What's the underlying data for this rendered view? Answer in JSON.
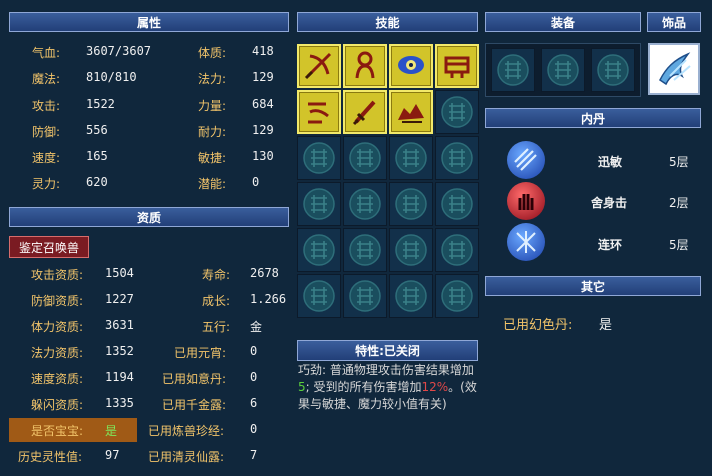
{
  "attributes": {
    "title": "属性",
    "rows": [
      {
        "l1": "气血:",
        "v1": "3607/3607",
        "l2": "体质:",
        "v2": "418"
      },
      {
        "l1": "魔法:",
        "v1": "810/810",
        "l2": "法力:",
        "v2": "129"
      },
      {
        "l1": "攻击:",
        "v1": "1522",
        "l2": "力量:",
        "v2": "684"
      },
      {
        "l1": "防御:",
        "v1": "556",
        "l2": "耐力:",
        "v2": "129"
      },
      {
        "l1": "速度:",
        "v1": "165",
        "l2": "敏捷:",
        "v2": "130"
      },
      {
        "l1": "灵力:",
        "v1": "620",
        "l2": "潜能:",
        "v2": "0"
      }
    ]
  },
  "aptitude": {
    "title": "资质",
    "appraise_button": "鉴定召唤兽",
    "rows": [
      {
        "l1": "攻击资质:",
        "v1": "1504",
        "l2": "寿命:",
        "v2": "2678"
      },
      {
        "l1": "防御资质:",
        "v1": "1227",
        "l2": "成长:",
        "v2": "1.266"
      },
      {
        "l1": "体力资质:",
        "v1": "3631",
        "l2": "五行:",
        "v2": "金"
      },
      {
        "l1": "法力资质:",
        "v1": "1352",
        "l2": "已用元宵:",
        "v2": "0"
      },
      {
        "l1": "速度资质:",
        "v1": "1194",
        "l2": "已用如意丹:",
        "v2": "0"
      },
      {
        "l1": "躲闪资质:",
        "v1": "1335",
        "l2": "已用千金露:",
        "v2": "6"
      },
      {
        "l1": "是否宝宝:",
        "v1": "是",
        "l2": "已用炼兽珍经:",
        "v2": "0"
      },
      {
        "l1": "历史灵性值:",
        "v1": "97",
        "l2": "已用清灵仙露:",
        "v2": "7"
      }
    ]
  },
  "skills": {
    "title": "技能",
    "filled_icons": [
      "bow-skill-icon",
      "monk-skill-icon",
      "eye-skill-icon",
      "chest-skill-icon",
      "bow-break-skill-icon",
      "sword-skill-icon",
      "beast-skill-icon"
    ]
  },
  "trait": {
    "title": "特性:已关闭",
    "text_a": "巧劲: 普通物理攻击伤害结果增加",
    "hl1": "5",
    "text_b": "; 受到的所有伤害增加",
    "hl2": "12%",
    "text_c": "。(效果与敏捷、魔力较小值有关)"
  },
  "equipment": {
    "title": "装备",
    "ornament_title": "饰品"
  },
  "inner_dan": {
    "title": "内丹",
    "items": [
      {
        "name": "迅敏",
        "level": "5层",
        "color": "#2a5fd0"
      },
      {
        "name": "舍身击",
        "level": "2层",
        "color": "#c0182a"
      },
      {
        "name": "连环",
        "level": "5层",
        "color": "#2a5fd0"
      }
    ]
  },
  "other": {
    "title": "其它",
    "label": "已用幻色丹:",
    "value": "是"
  },
  "colors": {
    "label": "#f2c46a",
    "header": "#2b4a86",
    "bg": "#10273c"
  }
}
